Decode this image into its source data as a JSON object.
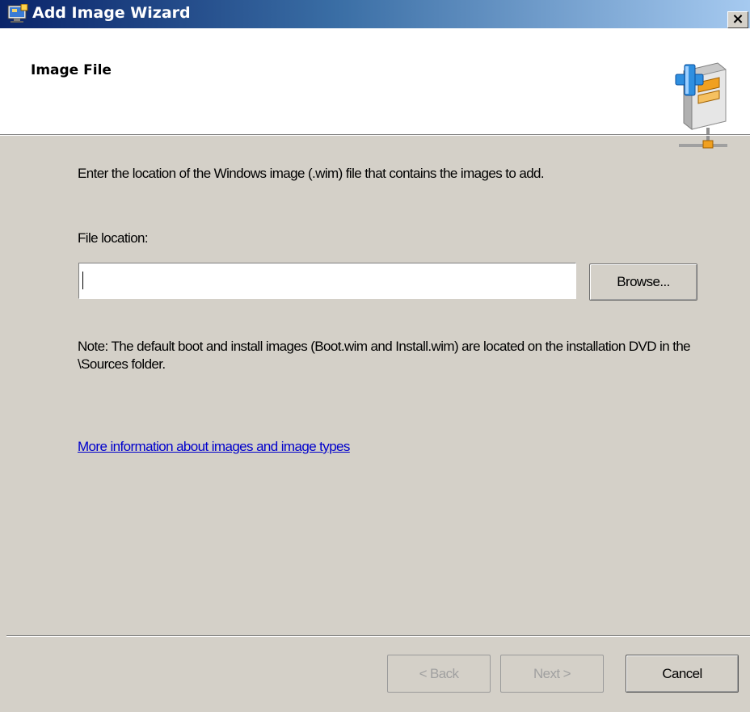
{
  "window": {
    "title": "Add Image Wizard",
    "close_label": "×",
    "title_icon": "wizard-app-icon",
    "colors": {
      "titlebar_start": "#0a246a",
      "titlebar_end": "#a6caf0",
      "body": "#d4d0c8",
      "link": "#0000cc"
    }
  },
  "header": {
    "page_title": "Image File",
    "icon": "add-image-icon"
  },
  "content": {
    "description": "Enter the location of the Windows image (.wim) file that contains the images to add.",
    "file_location_label": "File location:",
    "file_location_value": "",
    "browse_label": "Browse...",
    "note": "Note: The default boot and install images (Boot.wim and Install.wim) are located on the installation DVD in the \\Sources folder.",
    "link_text": "More information about images and image types"
  },
  "footer": {
    "back_label": "< Back",
    "next_label": "Next >",
    "cancel_label": "Cancel",
    "back_enabled": false,
    "next_enabled": false
  }
}
